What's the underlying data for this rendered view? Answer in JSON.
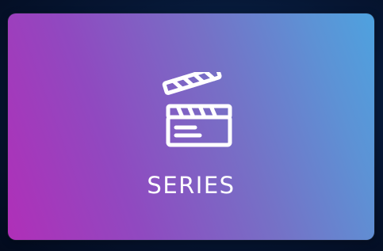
{
  "tile": {
    "label": "SERIES",
    "icon": "clapperboard-icon"
  }
}
